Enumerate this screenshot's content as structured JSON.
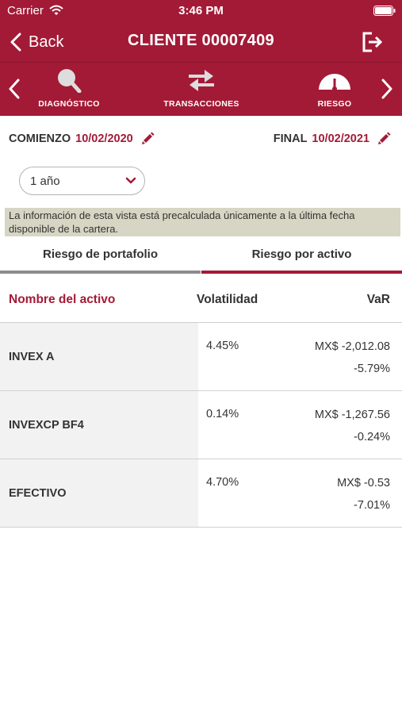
{
  "status_bar": {
    "carrier": "Carrier",
    "time": "3:46 PM"
  },
  "nav": {
    "back_label": "Back",
    "title": "CLIENTE 00007409"
  },
  "sections": [
    {
      "label": "DIAGNÓSTICO",
      "icon": "magnifier-icon"
    },
    {
      "label": "TRANSACCIONES",
      "icon": "exchange-arrows-icon"
    },
    {
      "label": "RIESGO",
      "icon": "gauge-icon"
    }
  ],
  "dates": {
    "start_label": "COMIENZO",
    "start_value": "10/02/2020",
    "end_label": "FINAL",
    "end_value": "10/02/2021"
  },
  "period": {
    "selected": "1 año"
  },
  "info_text": "La información de esta vista está precalculada únicamente a la última fecha disponible de la cartera.",
  "sub_tabs": [
    {
      "label": "Riesgo de portafolio",
      "active": false
    },
    {
      "label": "Riesgo por activo",
      "active": true
    }
  ],
  "table": {
    "headers": {
      "name": "Nombre del activo",
      "volatility": "Volatilidad",
      "var": "VaR"
    },
    "rows": [
      {
        "name": "INVEX A",
        "volatility": "4.45%",
        "var_amount": "MX$ -2,012.08",
        "var_pct": "-5.79%"
      },
      {
        "name": "INVEXCP BF4",
        "volatility": "0.14%",
        "var_amount": "MX$ -1,267.56",
        "var_pct": "-0.24%"
      },
      {
        "name": "EFECTIVO",
        "volatility": "4.70%",
        "var_amount": "MX$ -0.53",
        "var_pct": "-7.01%"
      }
    ]
  },
  "colors": {
    "brand": "#a31a36",
    "banner": "#d7d5c3",
    "row_name_bg": "#f2f2f2"
  }
}
